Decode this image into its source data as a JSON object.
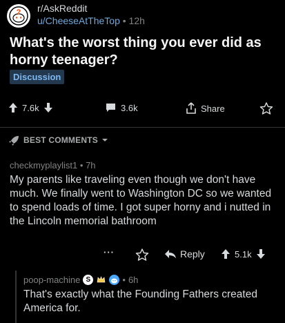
{
  "post": {
    "subreddit": "r/AskReddit",
    "author": "u/CheeseAtTheTop",
    "separator": "•",
    "age": "12h",
    "title": "What's the worst thing you ever did as horny teenager?",
    "flair": "Discussion",
    "upvotes": "7.6k",
    "comments": "3.6k",
    "share_label": "Share"
  },
  "sort": {
    "label": "BEST COMMENTS"
  },
  "comment1": {
    "author": "checkmyplaylist1",
    "separator": "•",
    "age": "7h",
    "body": "My parents like traveling even though we don't have much. We finally went to Washington DC so we wanted to spend loads of time. I got super horny and i nutted in the Lincoln memorial bathroom",
    "more": "···",
    "reply_label": "Reply",
    "score": "5.1k"
  },
  "comment2": {
    "author": "poop-machine",
    "separator": "•",
    "age": "6h",
    "body": "That's exactly what the Founding Fathers created America for."
  },
  "colors": {
    "background": "#000000",
    "author_blue": "#6fa8dc",
    "flair_bg": "#24384d",
    "flair_text": "#7db7f0"
  }
}
